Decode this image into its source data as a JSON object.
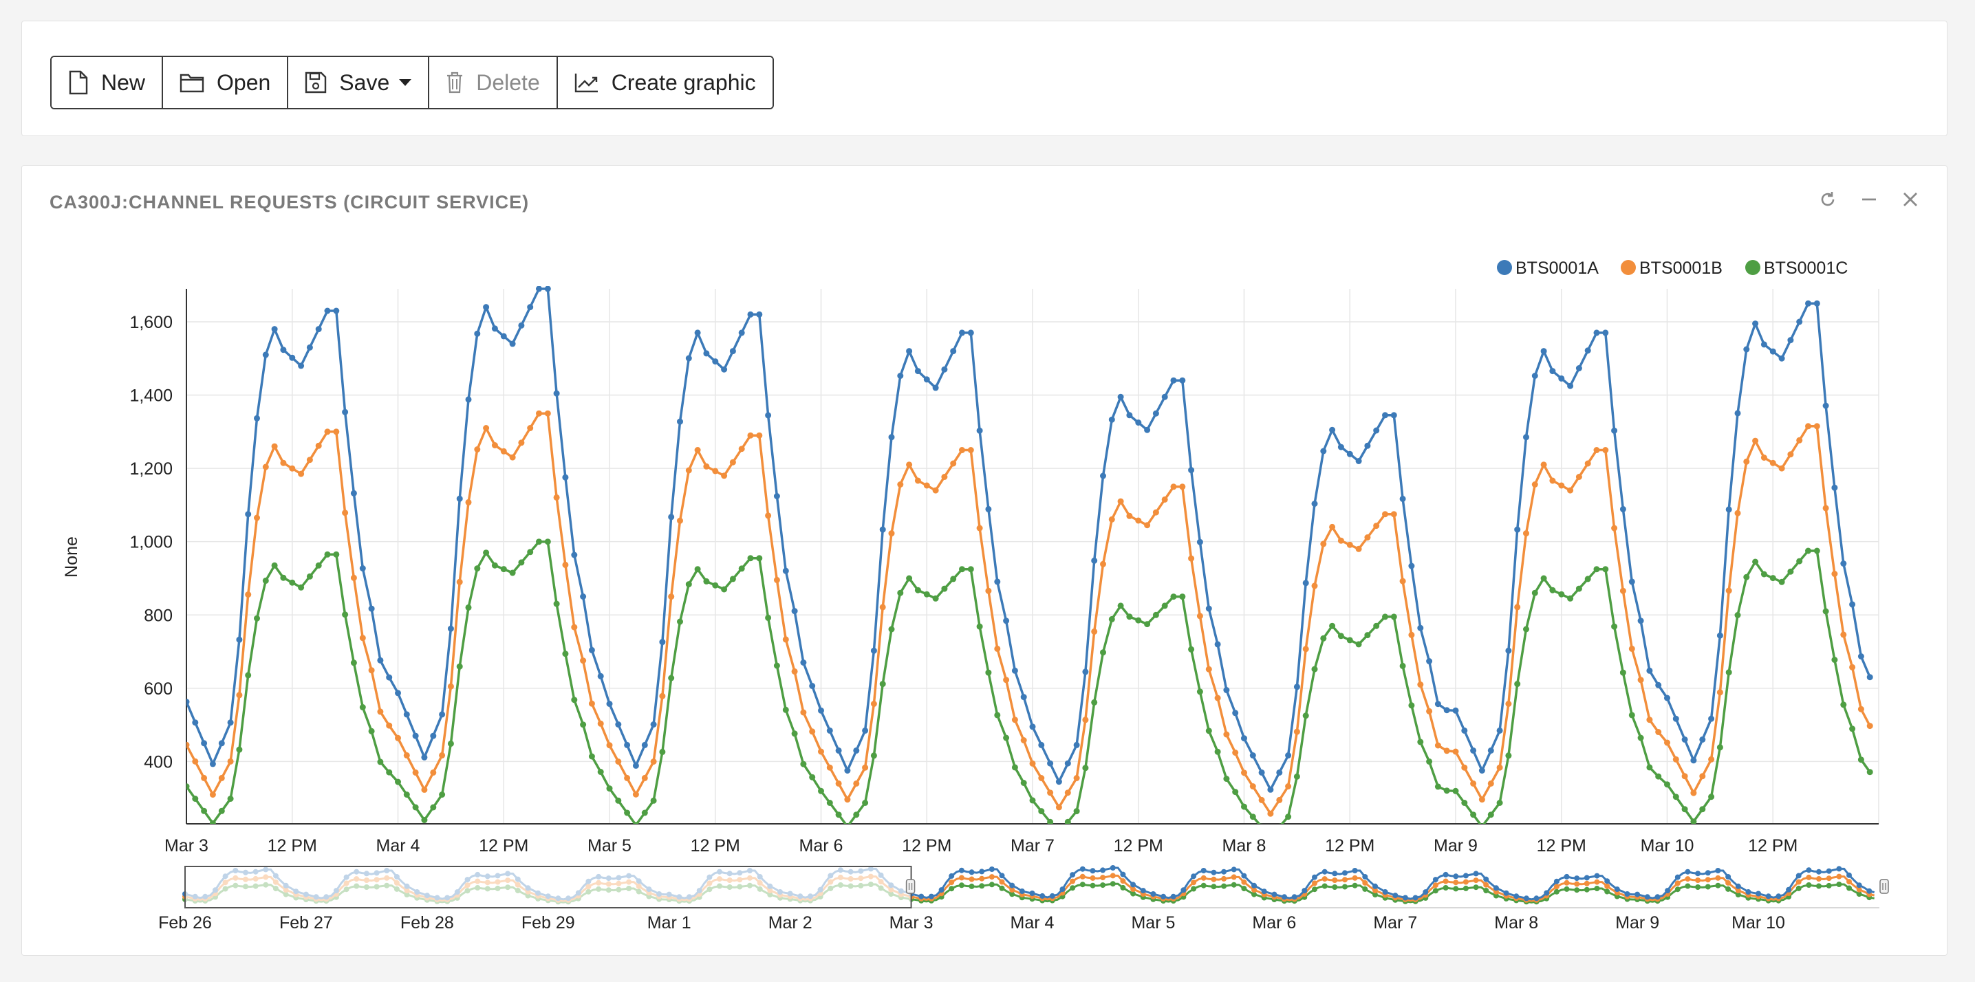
{
  "toolbar": {
    "new_label": "New",
    "open_label": "Open",
    "save_label": "Save",
    "delete_label": "Delete",
    "create_label": "Create graphic"
  },
  "panel": {
    "title": "CA300J:CHANNEL REQUESTS (CIRCUIT SERVICE)"
  },
  "colors": {
    "BTS0001A": "#3c7ab8",
    "BTS0001B": "#f28e3b",
    "BTS0001C": "#4e9e43"
  },
  "chart_data": {
    "type": "line",
    "ylabel": "None",
    "ylim": [
      230,
      1690
    ],
    "yticks": [
      400,
      600,
      800,
      1000,
      1200,
      1400,
      1600
    ],
    "ytick_labels": [
      "400",
      "600",
      "800",
      "1,000",
      "1,200",
      "1,400",
      "1,600"
    ],
    "xrange": [
      "Mar 3 00:00",
      "Mar 10 23:00"
    ],
    "xtick_labels": [
      "Mar 3",
      "12 PM",
      "Mar 4",
      "12 PM",
      "Mar 5",
      "12 PM",
      "Mar 6",
      "12 PM",
      "Mar 7",
      "12 PM",
      "Mar 8",
      "12 PM",
      "Mar 9",
      "12 PM",
      "Mar 10",
      "12 PM"
    ],
    "legend": "top-right",
    "grid": true,
    "series": [
      {
        "name": "BTS0001A",
        "days": [
          "Mar 3",
          "Mar 4",
          "Mar 5",
          "Mar 6",
          "Mar 7",
          "Mar 8",
          "Mar 9",
          "Mar 10"
        ],
        "night_low": [
          450,
          470,
          445,
          430,
          395,
          370,
          430,
          460
        ],
        "morning_peak": [
          1580,
          1640,
          1570,
          1520,
          1395,
          1305,
          1520,
          1595
        ],
        "midday_dip": [
          1480,
          1540,
          1470,
          1420,
          1305,
          1220,
          1425,
          1500
        ],
        "evening_peak": [
          1630,
          1690,
          1620,
          1570,
          1440,
          1345,
          1570,
          1650
        ]
      },
      {
        "name": "BTS0001B",
        "days": [
          "Mar 3",
          "Mar 4",
          "Mar 5",
          "Mar 6",
          "Mar 7",
          "Mar 8",
          "Mar 9",
          "Mar 10"
        ],
        "night_low": [
          355,
          370,
          355,
          340,
          315,
          295,
          340,
          360
        ],
        "morning_peak": [
          1260,
          1310,
          1250,
          1210,
          1110,
          1040,
          1210,
          1275
        ],
        "midday_dip": [
          1185,
          1230,
          1180,
          1140,
          1045,
          980,
          1140,
          1200
        ],
        "evening_peak": [
          1300,
          1350,
          1290,
          1250,
          1150,
          1075,
          1250,
          1315
        ]
      },
      {
        "name": "BTS0001C",
        "days": [
          "Mar 3",
          "Mar 4",
          "Mar 5",
          "Mar 6",
          "Mar 7",
          "Mar 8",
          "Mar 9",
          "Mar 10"
        ],
        "night_low": [
          265,
          275,
          260,
          255,
          235,
          222,
          255,
          270
        ],
        "morning_peak": [
          935,
          970,
          925,
          900,
          825,
          770,
          900,
          945
        ],
        "midday_dip": [
          875,
          915,
          870,
          845,
          775,
          720,
          845,
          890
        ],
        "evening_peak": [
          965,
          1000,
          955,
          925,
          850,
          795,
          925,
          975
        ]
      }
    ],
    "navigator": {
      "xtick_labels": [
        "Feb 26",
        "Feb 27",
        "Feb 28",
        "Feb 29",
        "Mar 1",
        "Mar 2",
        "Mar 3",
        "Mar 4",
        "Mar 5",
        "Mar 6",
        "Mar 7",
        "Mar 8",
        "Mar 9",
        "Mar 10"
      ],
      "selection_start": "Feb 26",
      "selection_end": "Mar 3"
    }
  }
}
